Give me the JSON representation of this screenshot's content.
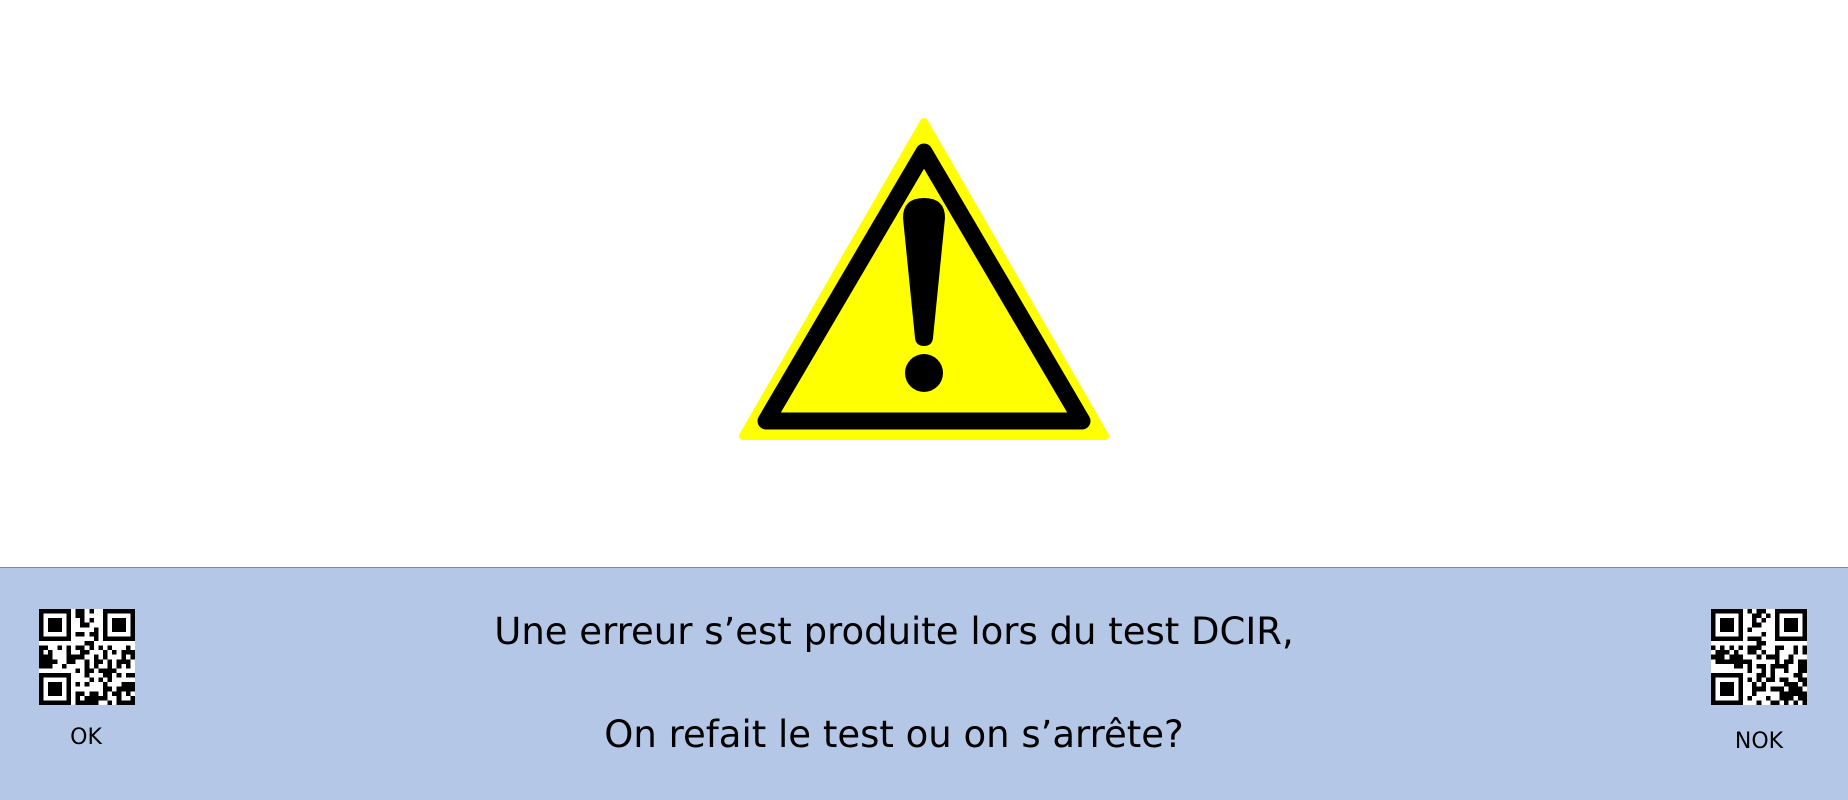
{
  "dialog": {
    "icon": "warning-icon",
    "message_line1": "Une erreur s’est produite lors du test DCIR,",
    "message_line2": "On refait le test ou on s’arrête?",
    "ok_label": "OK",
    "nok_label": "NOK"
  },
  "colors": {
    "panel_background": "#b4c7e7",
    "warning_fill": "#ffff00",
    "warning_stroke": "#000000"
  }
}
